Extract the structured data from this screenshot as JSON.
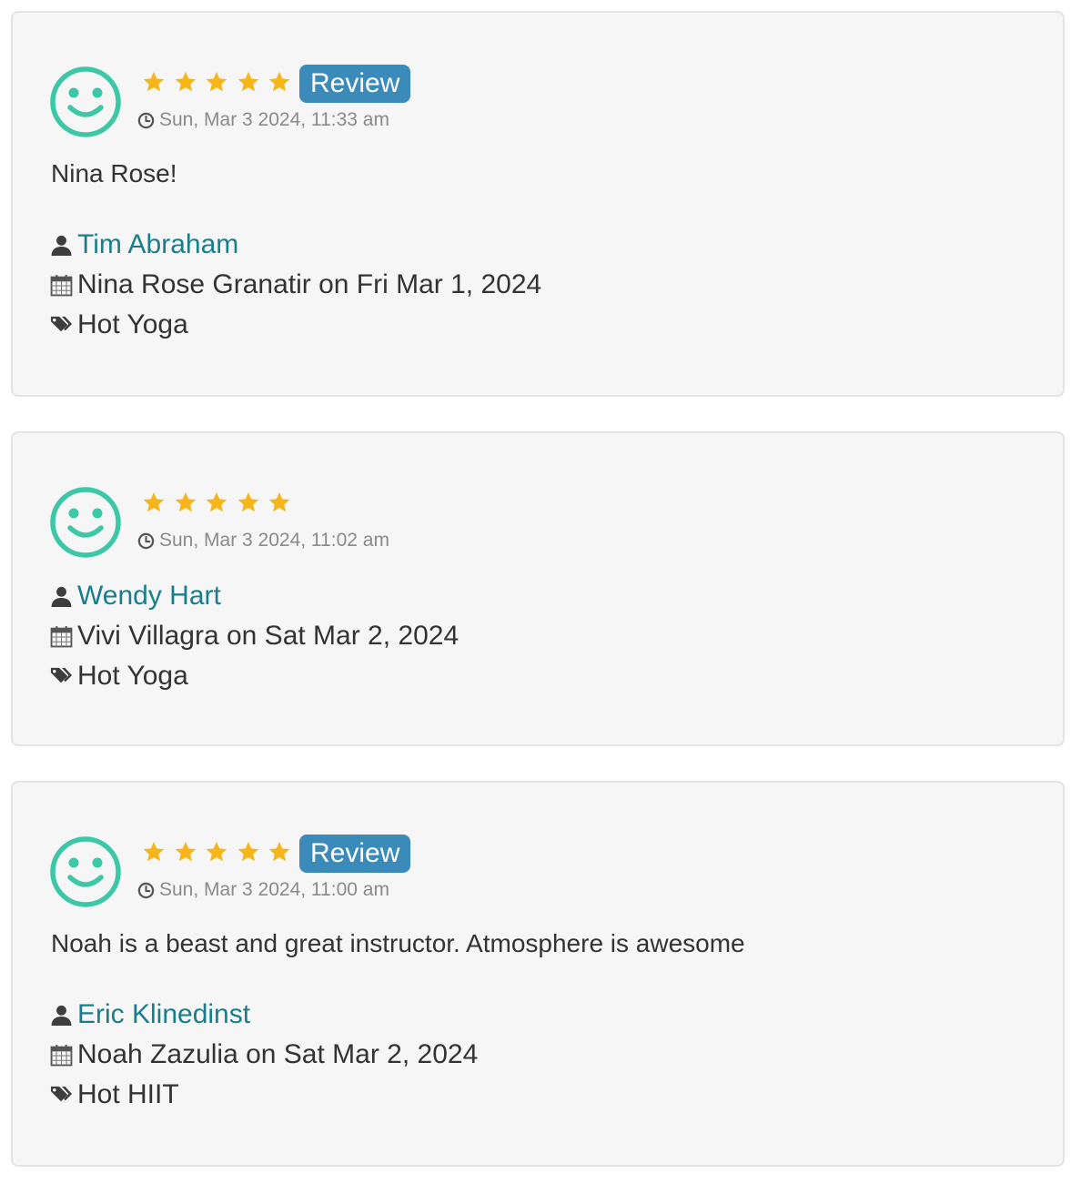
{
  "colors": {
    "card_background": "#f6f6f6",
    "card_border": "#e3e3e3",
    "star": "#f6b519",
    "badge": "#3b8bba",
    "face": "#3cc7a6",
    "link": "#177e8e",
    "muted": "#8a8a8a"
  },
  "icons": {
    "face": "smiley-face-icon",
    "star": "star-icon",
    "clock": "clock-icon",
    "user": "user-icon",
    "calendar": "calendar-icon",
    "tag": "tag-icon"
  },
  "reviews": [
    {
      "rating": 5,
      "badge": "Review",
      "timestamp": "Sun, Mar 3 2024, 11:33 am",
      "comment": "Nina Rose!",
      "reviewer": "Tim Abraham",
      "session": "Nina Rose Granatir on Fri Mar 1, 2024",
      "class_name": "Hot Yoga"
    },
    {
      "rating": 5,
      "timestamp": "Sun, Mar 3 2024, 11:02 am",
      "reviewer": "Wendy Hart",
      "session": "Vivi Villagra on Sat Mar 2, 2024",
      "class_name": "Hot Yoga"
    },
    {
      "rating": 5,
      "badge": "Review",
      "timestamp": "Sun, Mar 3 2024, 11:00 am",
      "comment": "Noah is a beast and great instructor. Atmosphere is awesome",
      "reviewer": "Eric Klinedinst",
      "session": "Noah Zazulia on Sat Mar 2, 2024",
      "class_name": "Hot HIIT"
    }
  ]
}
